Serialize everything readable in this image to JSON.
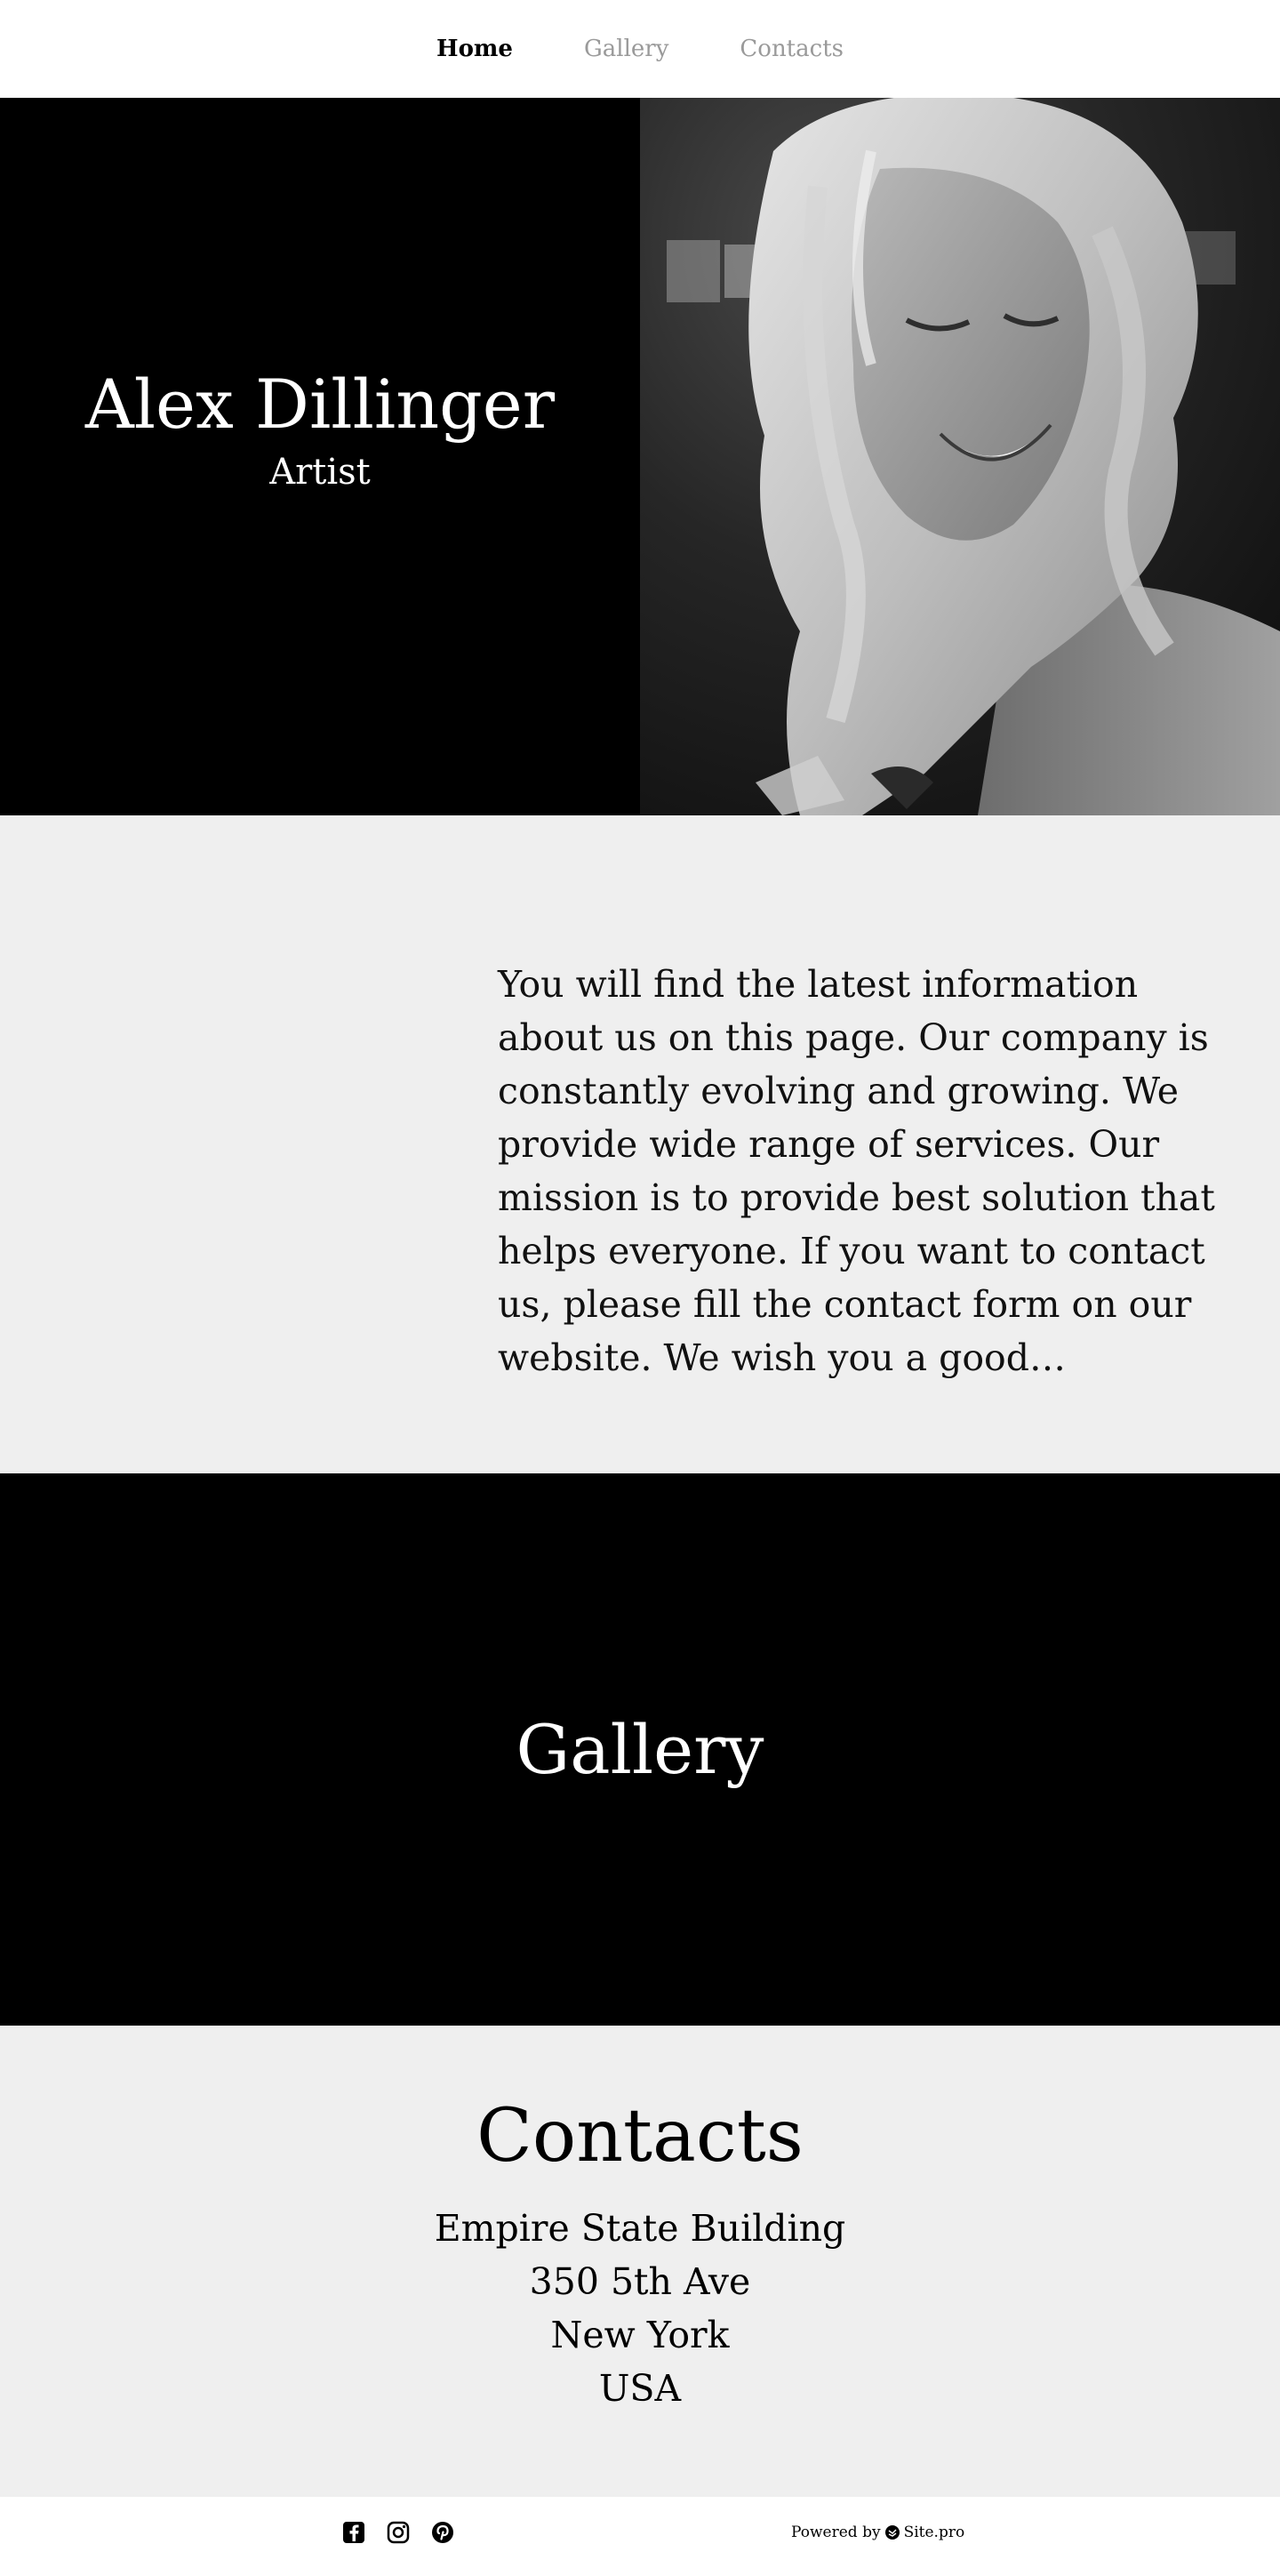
{
  "nav": {
    "items": [
      {
        "label": "Home",
        "active": true
      },
      {
        "label": "Gallery",
        "active": false
      },
      {
        "label": "Contacts",
        "active": false
      }
    ]
  },
  "hero": {
    "name": "Alex Dillinger",
    "role": "Artist",
    "photo_icon": "portrait-photo"
  },
  "about": {
    "text": "You will find the latest information about us on this page. Our company is constantly evolving and growing. We provide wide range of services. Our mission is to provide best solution that helps everyone. If you want to contact us, please fill the contact form on our website. We wish you a good…"
  },
  "gallery": {
    "title": "Gallery"
  },
  "contacts": {
    "title": "Contacts",
    "address": [
      "Empire State Building",
      "350 5th Ave",
      "New York",
      "USA"
    ]
  },
  "footer": {
    "socials": [
      "facebook-icon",
      "instagram-icon",
      "pinterest-icon"
    ],
    "powered_by": "Powered by",
    "brand": "Site.pro"
  },
  "colors": {
    "black": "#000000",
    "light_gray_bg": "#efefef",
    "nav_inactive": "#9a9a9a",
    "white": "#ffffff"
  }
}
